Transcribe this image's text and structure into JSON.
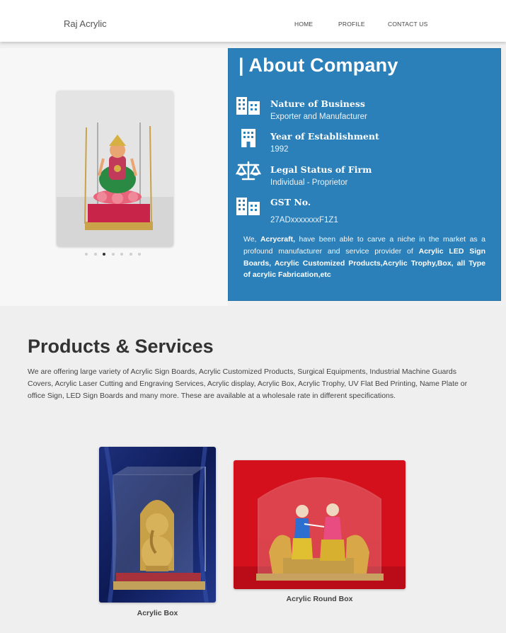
{
  "header": {
    "brand": "Raj Acrylic",
    "nav": [
      {
        "label": "HOME"
      },
      {
        "label": "PROFILE"
      },
      {
        "label": "CONTACT US"
      }
    ]
  },
  "carousel": {
    "slide_count": 7,
    "active_index": 2
  },
  "about": {
    "title": "| About Company",
    "rows": [
      {
        "label": "Nature of Business",
        "value": "Exporter and Manufacturer",
        "icon": "building-icon"
      },
      {
        "label": "Year of Establishment",
        "value": "1992",
        "icon": "office-building-icon"
      },
      {
        "label": "Legal Status of Firm",
        "value": "Individual - Proprietor",
        "icon": "scale-icon"
      },
      {
        "label": "GST No.",
        "value": "27ADxxxxxxxF1Z1",
        "icon": "building-icon"
      }
    ],
    "desc": {
      "intro": "We, ",
      "company": "Acrycraft,",
      "middle": " have been able to carve a niche in the market as a profound manufacturer and service provider of ",
      "products": "Acrylic LED Sign Boards, Acrylic Customized Products,Acrylic Trophy,Box, all Type of acrylic Fabrication,etc"
    }
  },
  "products": {
    "title": "Products & Services",
    "desc": "We are offering large variety of Acrylic Sign Boards, Acrylic Customized Products, Surgical Equipments, Industrial Machine Guards Covers, Acrylic Laser Cutting and Engraving Services, Acrylic display, Acrylic Box, Acrylic Trophy, UV Flat Bed Printing, Name Plate or office Sign, LED Sign Boards and many more. These are available at a wholesale rate in different specifications.",
    "items": [
      {
        "caption": "Acrylic Box"
      },
      {
        "caption": "Acrylic Round Box"
      }
    ]
  },
  "colors": {
    "about_bg": "#2b80b9",
    "page_bg": "#f0f0f0"
  }
}
